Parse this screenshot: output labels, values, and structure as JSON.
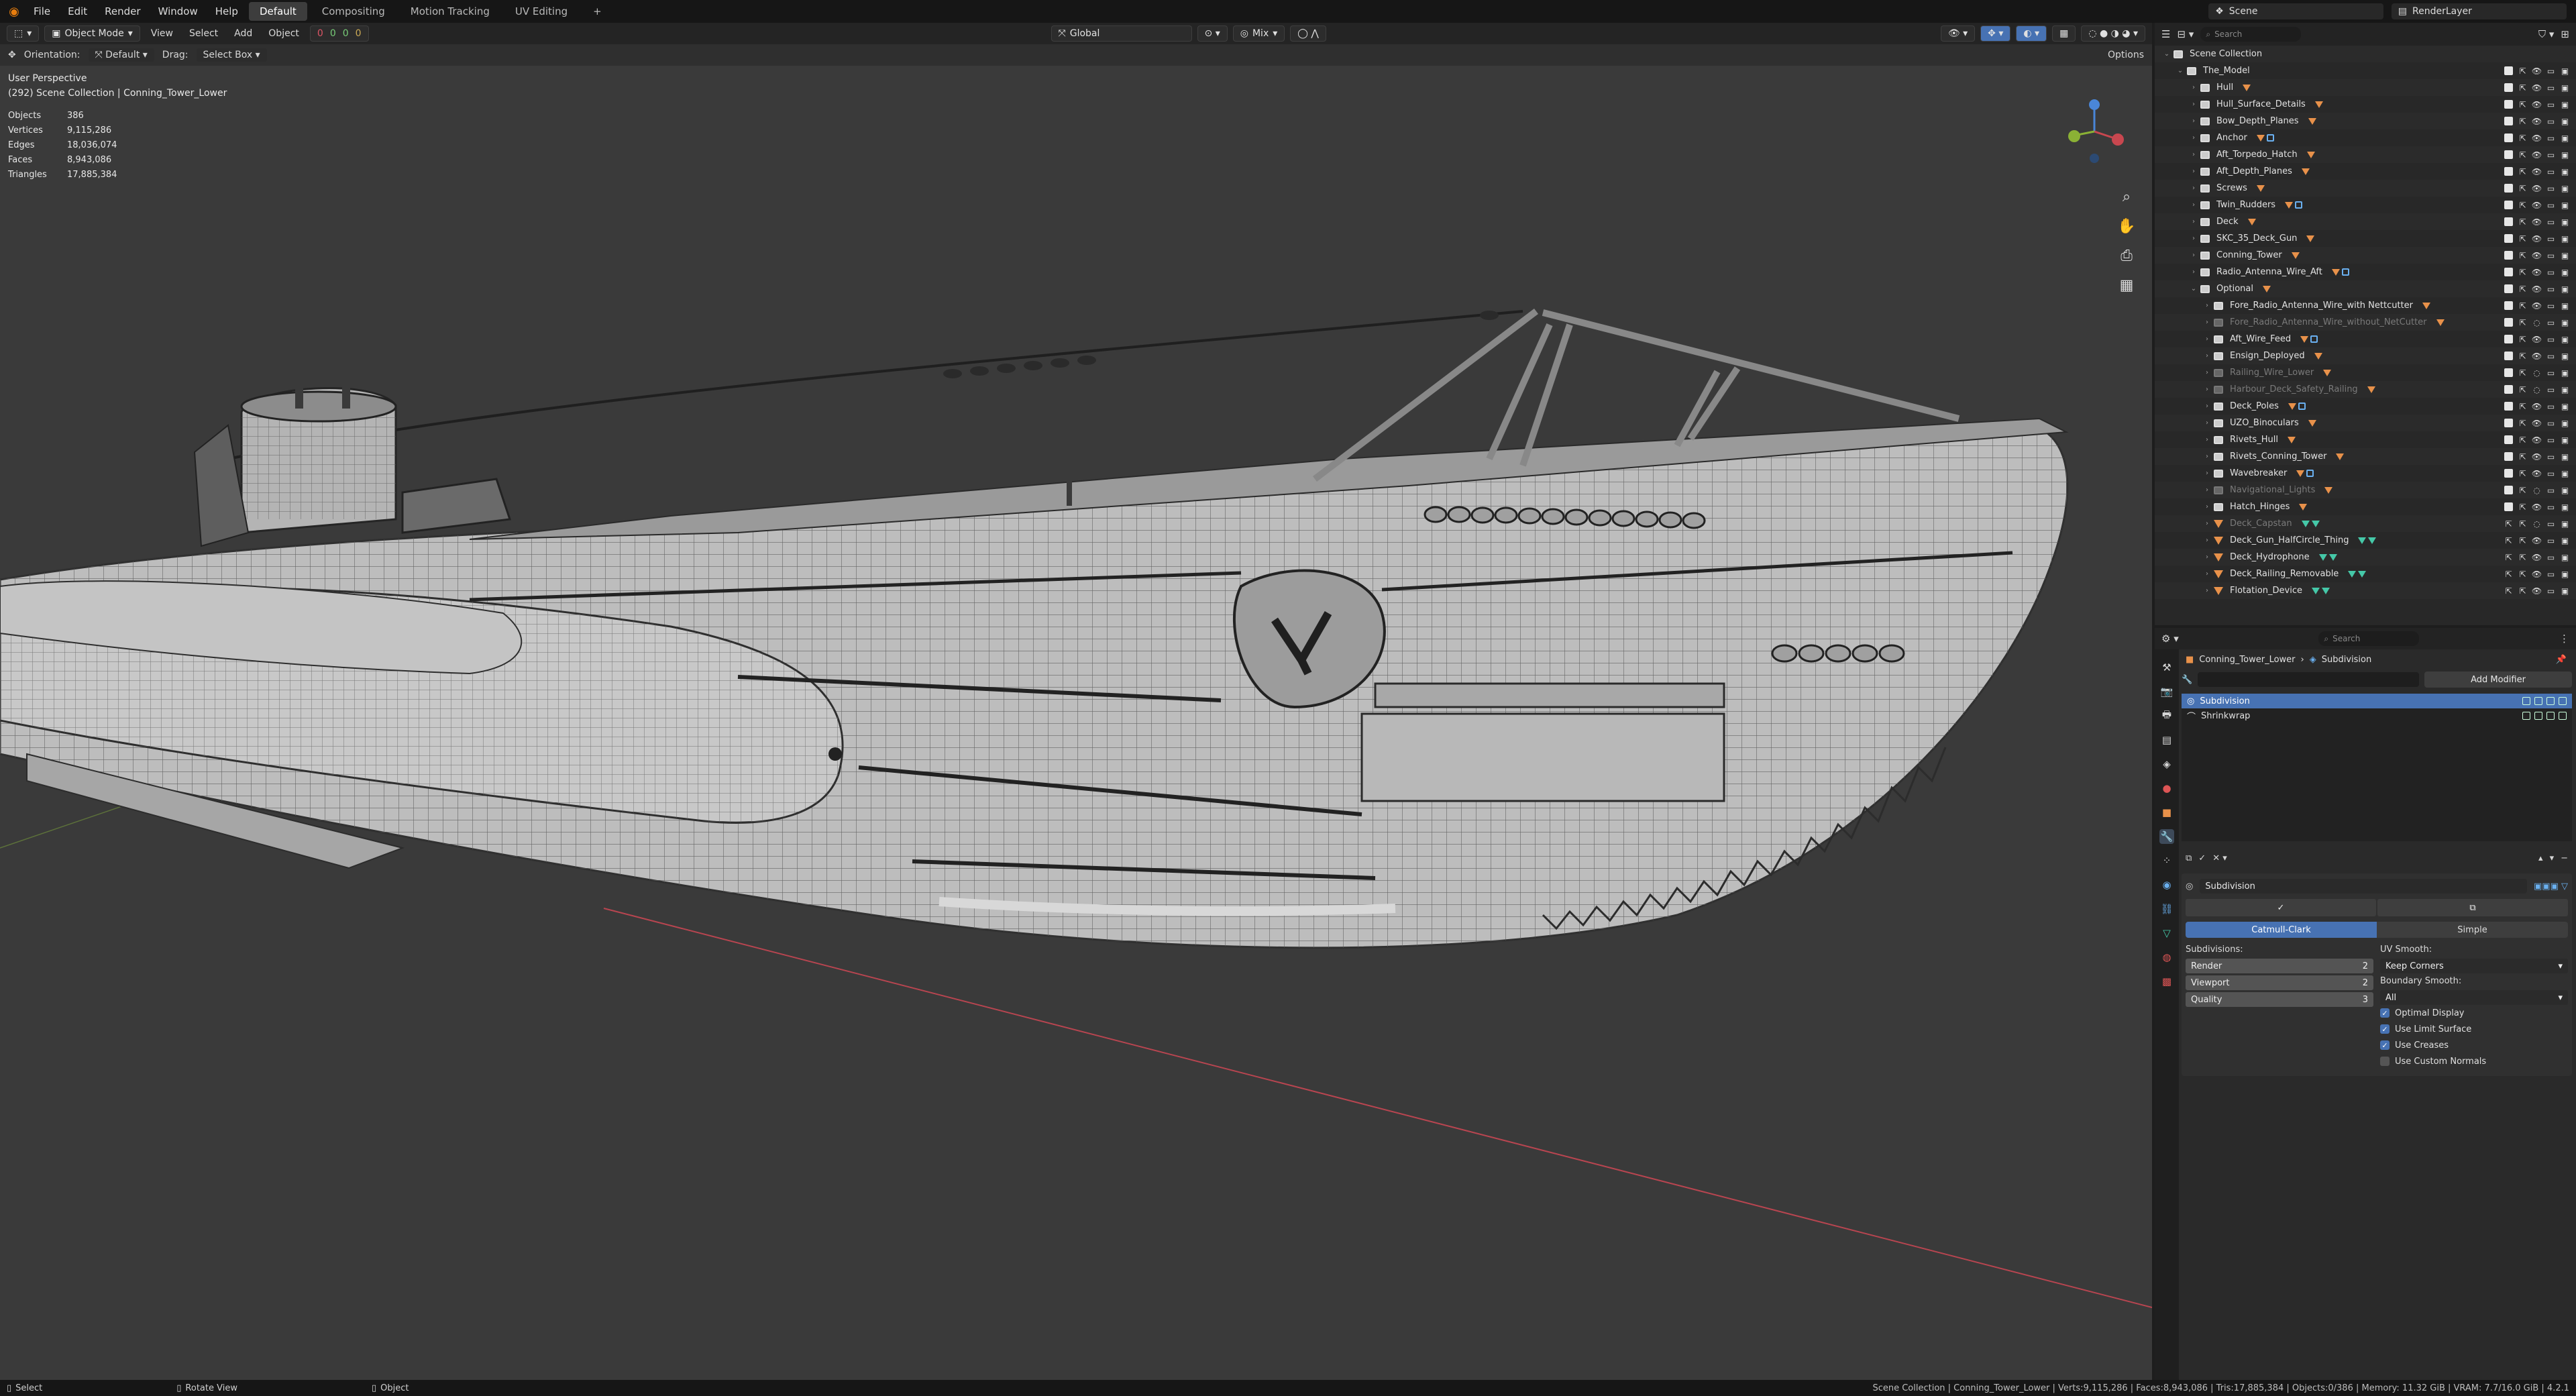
{
  "menubar": {
    "menus": [
      "File",
      "Edit",
      "Render",
      "Window",
      "Help"
    ],
    "workspaces": [
      "Default",
      "Compositing",
      "Motion Tracking",
      "UV Editing"
    ],
    "active_workspace": "Default",
    "scene": "Scene",
    "view_layer": "RenderLayer"
  },
  "viewport": {
    "mode": "Object Mode",
    "menus": [
      "View",
      "Select",
      "Add",
      "Object"
    ],
    "transform_orientation": "Global",
    "proportional": "Mix",
    "tool_orientation_label": "Orientation:",
    "tool_orientation_value": "Default",
    "drag_label": "Drag:",
    "drag_value": "Select Box",
    "options": "Options",
    "perspective": "User Perspective",
    "collection_line": "(292) Scene Collection | Conning_Tower_Lower",
    "stats": [
      {
        "k": "Objects",
        "v": "386"
      },
      {
        "k": "Vertices",
        "v": "9,115,286"
      },
      {
        "k": "Edges",
        "v": "18,036,074"
      },
      {
        "k": "Faces",
        "v": "8,943,086"
      },
      {
        "k": "Triangles",
        "v": "17,885,384"
      }
    ],
    "counters": [
      "0",
      "0",
      "0",
      "0"
    ]
  },
  "outliner": {
    "search_placeholder": "Search",
    "rows": [
      {
        "label": "Scene Collection",
        "indent": 0,
        "type": "scene",
        "open": true
      },
      {
        "label": "The_Model",
        "indent": 1,
        "type": "coll",
        "open": true
      },
      {
        "label": "Hull",
        "indent": 2,
        "type": "coll"
      },
      {
        "label": "Hull_Surface_Details",
        "indent": 2,
        "type": "coll"
      },
      {
        "label": "Bow_Depth_Planes",
        "indent": 2,
        "type": "coll"
      },
      {
        "label": "Anchor",
        "indent": 2,
        "type": "coll"
      },
      {
        "label": "Aft_Torpedo_Hatch",
        "indent": 2,
        "type": "coll"
      },
      {
        "label": "Aft_Depth_Planes",
        "indent": 2,
        "type": "coll"
      },
      {
        "label": "Screws",
        "indent": 2,
        "type": "coll"
      },
      {
        "label": "Twin_Rudders",
        "indent": 2,
        "type": "coll"
      },
      {
        "label": "Deck",
        "indent": 2,
        "type": "coll"
      },
      {
        "label": "SKC_35_Deck_Gun",
        "indent": 2,
        "type": "coll"
      },
      {
        "label": "Conning_Tower",
        "indent": 2,
        "type": "coll"
      },
      {
        "label": "Radio_Antenna_Wire_Aft",
        "indent": 2,
        "type": "coll"
      },
      {
        "label": "Optional",
        "indent": 2,
        "type": "coll",
        "open": true
      },
      {
        "label": "Fore_Radio_Antenna_Wire_with Nettcutter",
        "indent": 3,
        "type": "coll"
      },
      {
        "label": "Fore_Radio_Antenna_Wire_without_NetCutter",
        "indent": 3,
        "type": "coll",
        "dim": true
      },
      {
        "label": "Aft_Wire_Feed",
        "indent": 3,
        "type": "coll"
      },
      {
        "label": "Ensign_Deployed",
        "indent": 3,
        "type": "coll"
      },
      {
        "label": "Railing_Wire_Lower",
        "indent": 3,
        "type": "coll",
        "dim": true
      },
      {
        "label": "Harbour_Deck_Safety_Railing",
        "indent": 3,
        "type": "coll",
        "dim": true
      },
      {
        "label": "Deck_Poles",
        "indent": 3,
        "type": "coll"
      },
      {
        "label": "UZO_Binoculars",
        "indent": 3,
        "type": "coll"
      },
      {
        "label": "Rivets_Hull",
        "indent": 3,
        "type": "coll"
      },
      {
        "label": "Rivets_Conning_Tower",
        "indent": 3,
        "type": "coll"
      },
      {
        "label": "Wavebreaker",
        "indent": 3,
        "type": "coll"
      },
      {
        "label": "Navigational_Lights",
        "indent": 3,
        "type": "coll",
        "dim": true
      },
      {
        "label": "Hatch_Hinges",
        "indent": 3,
        "type": "coll"
      },
      {
        "label": "Deck_Capstan",
        "indent": 3,
        "type": "mesh",
        "dim": true
      },
      {
        "label": "Deck_Gun_HalfCircle_Thing",
        "indent": 3,
        "type": "mesh"
      },
      {
        "label": "Deck_Hydrophone",
        "indent": 3,
        "type": "mesh"
      },
      {
        "label": "Deck_Railing_Removable",
        "indent": 3,
        "type": "mesh"
      },
      {
        "label": "Flotation_Device",
        "indent": 3,
        "type": "mesh"
      }
    ]
  },
  "properties": {
    "search_placeholder": "Search",
    "object_name": "Conning_Tower_Lower",
    "modifier_tab": "Subdivision",
    "add_modifier": "Add Modifier",
    "stack": [
      "Subdivision",
      "Shrinkwrap"
    ],
    "panel": {
      "name": "Subdivision",
      "algorithm_on": "Catmull-Clark",
      "algorithm_off": "Simple",
      "subdivisions_label": "Subdivisions:",
      "render_label": "Render",
      "render_value": "2",
      "viewport_label": "Viewport",
      "viewport_value": "2",
      "quality_label": "Quality",
      "quality_value": "3",
      "uv_smooth_label": "UV Smooth:",
      "uv_smooth_value": "Keep Corners",
      "boundary_smooth_label": "Boundary Smooth:",
      "boundary_smooth_value": "All",
      "checks": [
        {
          "label": "Optimal Display",
          "on": true
        },
        {
          "label": "Use Limit Surface",
          "on": true
        },
        {
          "label": "Use Creases",
          "on": true
        },
        {
          "label": "Use Custom Normals",
          "on": false
        }
      ]
    }
  },
  "statusbar": {
    "select": "Select",
    "rotate": "Rotate View",
    "object": "Object",
    "info": "Scene Collection | Conning_Tower_Lower | Verts:9,115,286 | Faces:8,943,086 | Tris:17,885,384 | Objects:0/386 | Memory: 11.32 GiB | VRAM: 7.7/16.0 GiB | 4.2.1"
  },
  "colors": {
    "accent": "#4772b3",
    "mesh_icon": "#e8914a",
    "viewport_bg": "#3a3a3a",
    "x_axis": "#c8474f",
    "y_axis": "#8bb135"
  }
}
